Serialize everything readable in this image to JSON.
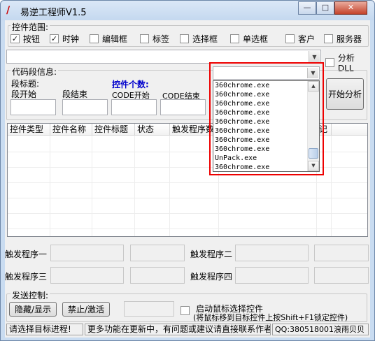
{
  "window": {
    "title": "易逆工程师V1.5",
    "icon": "app-logo-icon"
  },
  "controls_group": {
    "title": "控件范围:",
    "checkboxes": [
      {
        "label": "按钮",
        "checked": true
      },
      {
        "label": "时钟",
        "checked": true
      },
      {
        "label": "编辑框",
        "checked": false
      },
      {
        "label": "标签",
        "checked": false
      },
      {
        "label": "选择框",
        "checked": false
      },
      {
        "label": "单选框",
        "checked": false
      },
      {
        "label": "客户",
        "checked": false
      },
      {
        "label": "服务器",
        "checked": false
      }
    ]
  },
  "dll": {
    "label": "分析DLL",
    "checked": false
  },
  "code_group": {
    "title": "代码段信息:",
    "label_title": "段标题:",
    "count_label": "控件个数:",
    "seg_start": "段开始",
    "seg_end": "段结束",
    "code_start": "CODE开始",
    "code_end": "CODE结束"
  },
  "analyze_button": "开始分析",
  "table": {
    "headers": [
      "控件类型",
      "控件名称",
      "控件标题",
      "状态",
      "触发程序数",
      "记"
    ]
  },
  "dropdown": {
    "items": [
      "360chrome.exe",
      "360chrome.exe",
      "360chrome.exe",
      "360chrome.exe",
      "360chrome.exe",
      "360chrome.exe",
      "360chrome.exe",
      "360chrome.exe",
      "UnPack.exe",
      "360chrome.exe"
    ]
  },
  "triggers": {
    "t1": "触发程序一",
    "t2": "触发程序二",
    "t3": "触发程序三",
    "t4": "触发程序四"
  },
  "send_group": {
    "title": "发送控制:",
    "hide_button": "隐藏/显示",
    "disable_button": "禁止/激活",
    "mouse_select_label": "启动鼠标选择控件",
    "mouse_select_hint": "(将鼠标移到目标控件上按Shift+F1锁定控件)"
  },
  "status_bar": {
    "left": "请选择目标进程!",
    "middle": "更多功能在更新中，有问题或建议请直接联系作者",
    "right": "QQ:380518001浪雨贝贝"
  },
  "colors": {
    "highlight_box": "#e00000",
    "group_title_blue": "#0000cc"
  }
}
